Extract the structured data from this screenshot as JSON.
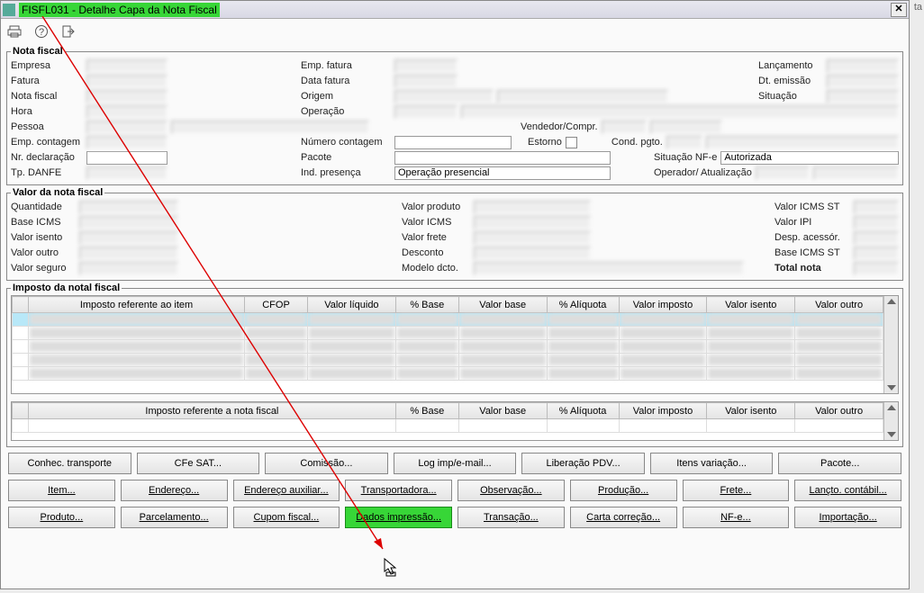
{
  "title": "FISFL031 - Detalhe Capa da Nota Fiscal",
  "corner": "ta",
  "sections": {
    "nota_fiscal": "Nota fiscal",
    "valor": "Valor da nota fiscal",
    "imposto": "Imposto da notal fiscal"
  },
  "labels": {
    "empresa": "Empresa",
    "fatura": "Fatura",
    "nota_fiscal": "Nota fiscal",
    "hora": "Hora",
    "pessoa": "Pessoa",
    "emp_contagem": "Emp. contagem",
    "nr_declaracao": "Nr. declaração",
    "tp_danfe": "Tp. DANFE",
    "emp_fatura": "Emp. fatura",
    "data_fatura": "Data fatura",
    "origem": "Origem",
    "operacao": "Operação",
    "numero_contagem": "Número contagem",
    "pacote": "Pacote",
    "ind_presenca": "Ind. presença",
    "lancamento": "Lançamento",
    "dt_emissao": "Dt. emissão",
    "situacao": "Situação",
    "vendedor_compr": "Vendedor/Compr.",
    "estorno": "Estorno",
    "cond_pgto": "Cond. pgto.",
    "situacao_nfe": "Situação NF-e",
    "operador_atualizacao": "Operador/ Atualização",
    "quantidade": "Quantidade",
    "base_icms": "Base ICMS",
    "valor_isento": "Valor isento",
    "valor_outro": "Valor outro",
    "valor_seguro": "Valor seguro",
    "valor_produto": "Valor produto",
    "valor_icms": "Valor ICMS",
    "valor_frete": "Valor frete",
    "desconto": "Desconto",
    "modelo_dcto": "Modelo dcto.",
    "valor_icms_st": "Valor ICMS ST",
    "valor_ipi": "Valor IPI",
    "desp_acessor": "Desp. acessór.",
    "base_icms_st": "Base ICMS ST",
    "total_nota": "Total nota"
  },
  "values": {
    "ind_presenca": "Operação presencial",
    "situacao_nfe": "Autorizada"
  },
  "tax_table": {
    "headers": [
      "Imposto referente ao item",
      "CFOP",
      "Valor líquido",
      "% Base",
      "Valor base",
      "% Alíquota",
      "Valor imposto",
      "Valor isento",
      "Valor outro"
    ],
    "note_headers": [
      "Imposto referente a nota fiscal",
      "",
      "",
      "% Base",
      "Valor base",
      "% Alíquota",
      "Valor imposto",
      "Valor isento",
      "Valor outro"
    ]
  },
  "buttons": {
    "r1": [
      "Conhec. transporte",
      "CFe SAT...",
      "Comissão...",
      "Log imp/e-mail...",
      "Liberação PDV...",
      "Itens variação...",
      "Pacote..."
    ],
    "r2": [
      "Item...",
      "Endereço...",
      "Endereço auxiliar...",
      "Transportadora...",
      "Observação...",
      "Produção...",
      "Frete...",
      "Lançto. contábil..."
    ],
    "r3": [
      "Produto...",
      "Parcelamento...",
      "Cupom fiscal...",
      "Dados impressão...",
      "Transação...",
      "Carta correção...",
      "NF-e...",
      "Importação..."
    ]
  }
}
